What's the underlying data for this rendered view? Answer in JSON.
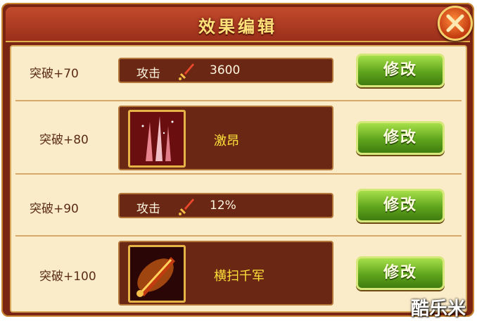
{
  "dialog": {
    "title": "效果编辑",
    "close_icon": "close-icon"
  },
  "rows": [
    {
      "label": "突破+70",
      "kind": "stat",
      "stat_name": "攻击",
      "stat_icon": "sword-icon",
      "value": "3600",
      "button": "修改"
    },
    {
      "label": "突破+80",
      "kind": "skill",
      "skill_icon": "light-beams-skill-icon",
      "skill_name": "激昂",
      "button": "修改"
    },
    {
      "label": "突破+90",
      "kind": "stat",
      "stat_name": "攻击",
      "stat_icon": "sword-icon",
      "value": "12%",
      "button": "修改"
    },
    {
      "label": "突破+100",
      "kind": "skill",
      "skill_icon": "flaming-sword-skill-icon",
      "skill_name": "横扫千军",
      "button": "修改"
    }
  ],
  "watermark": "酷乐米",
  "colors": {
    "frame": "#7a2414",
    "panel": "#fbecc9",
    "button_green": "#5fa41c",
    "skill_name": "#ffe23a"
  }
}
